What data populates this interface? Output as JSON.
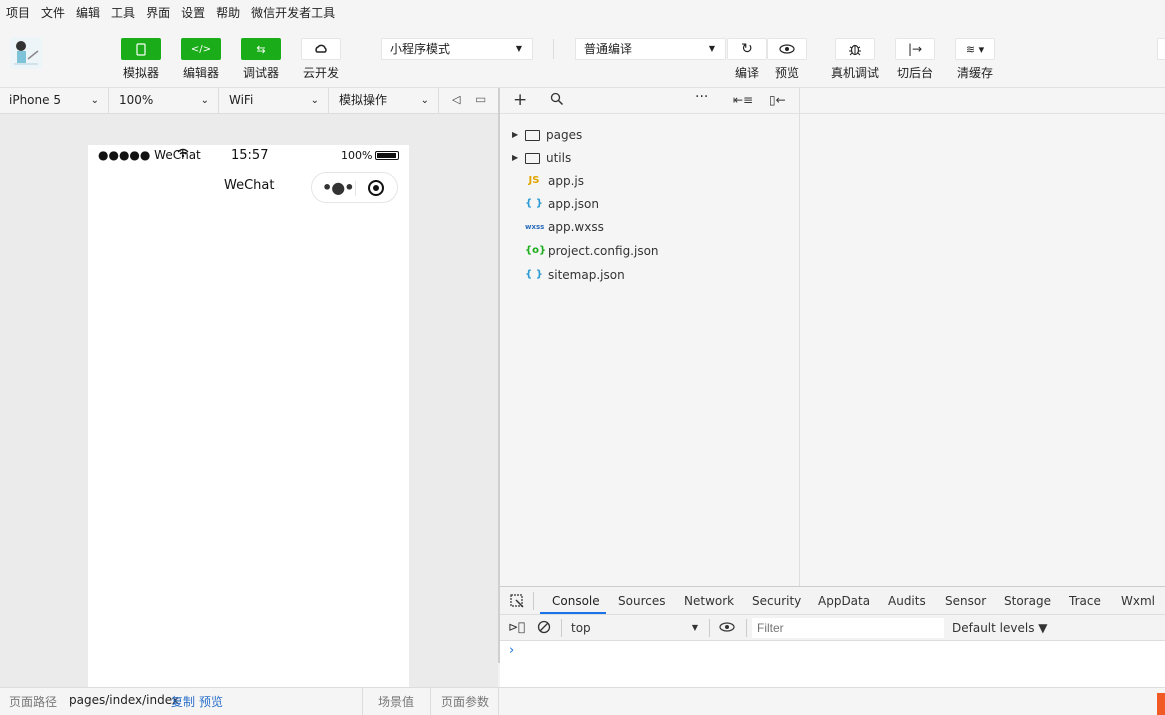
{
  "menu": [
    "项目",
    "文件",
    "编辑",
    "工具",
    "界面",
    "设置",
    "帮助",
    "微信开发者工具"
  ],
  "toolbar": {
    "simulator": "模拟器",
    "editor": "编辑器",
    "debugger": "调试器",
    "cloud": "云开发",
    "mode_select": "小程序模式",
    "compile_select": "普通编译",
    "compile": "编译",
    "preview": "预览",
    "real_debug": "真机调试",
    "background": "切后台",
    "clear_cache": "清缓存"
  },
  "sim_toolbar": {
    "device": "iPhone 5",
    "zoom": "100%",
    "network": "WiFi",
    "operation": "模拟操作"
  },
  "phone": {
    "signal": "●●●●● WeChat",
    "time": "15:57",
    "battery": "100%",
    "nav_title": "WeChat"
  },
  "file_tree": [
    {
      "type": "folder",
      "name": "pages"
    },
    {
      "type": "folder",
      "name": "utils"
    },
    {
      "type": "js",
      "icon": "JS",
      "name": "app.js"
    },
    {
      "type": "json",
      "icon": "{ }",
      "name": "app.json"
    },
    {
      "type": "wxss",
      "icon": "wxss",
      "name": "app.wxss"
    },
    {
      "type": "config",
      "icon": "{o}",
      "name": "project.config.json"
    },
    {
      "type": "json",
      "icon": "{ }",
      "name": "sitemap.json"
    }
  ],
  "devtools": {
    "tabs": [
      "Console",
      "Sources",
      "Network",
      "Security",
      "AppData",
      "Audits",
      "Sensor",
      "Storage",
      "Trace",
      "Wxml"
    ],
    "context": "top",
    "filter_placeholder": "Filter",
    "levels": "Default levels ▼",
    "prompt": "›"
  },
  "bottom": {
    "path_label": "页面路径",
    "path": "pages/index/index",
    "copy": "复制",
    "preview": "预览",
    "scene": "场景值",
    "params": "页面参数"
  },
  "colors": {
    "accent_green": "#1aad19",
    "link": "#2a6fc9",
    "console_active": "#1a73e8"
  }
}
